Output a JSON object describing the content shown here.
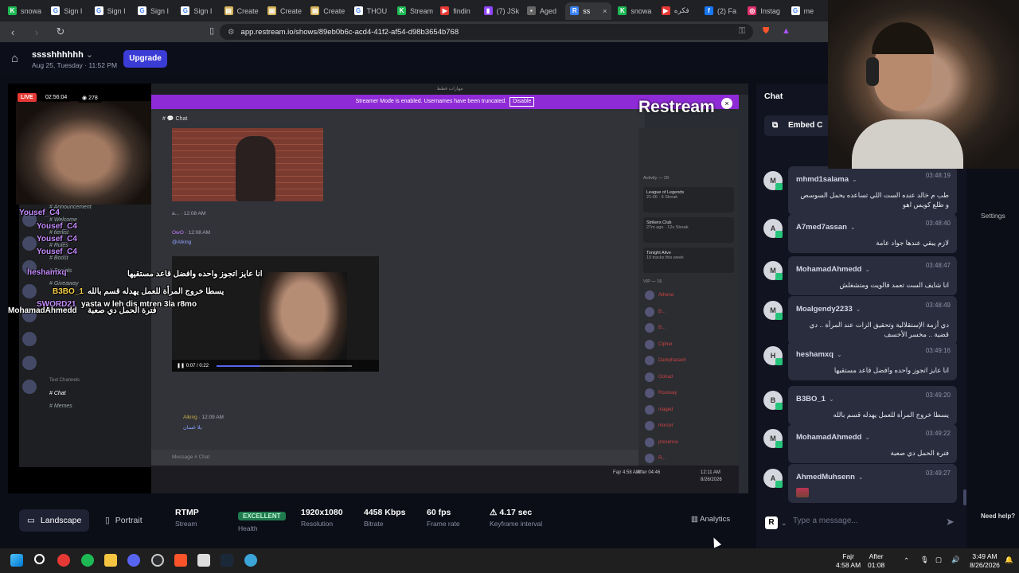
{
  "browser": {
    "tabs": [
      {
        "label": "snowa",
        "color": "#1db954",
        "glyph": "K"
      },
      {
        "label": "Sign I",
        "color": "#fff",
        "glyph": "G"
      },
      {
        "label": "Sign I",
        "color": "#fff",
        "glyph": "G"
      },
      {
        "label": "Sign I",
        "color": "#fff",
        "glyph": "G"
      },
      {
        "label": "Sign I",
        "color": "#fff",
        "glyph": "G"
      },
      {
        "label": "Create",
        "color": "#d4b35a",
        "glyph": "▤"
      },
      {
        "label": "Create",
        "color": "#d4b35a",
        "glyph": "▤"
      },
      {
        "label": "Create",
        "color": "#d4b35a",
        "glyph": "▤"
      },
      {
        "label": "THOU",
        "color": "#fff",
        "glyph": "G"
      },
      {
        "label": "Stream",
        "color": "#1db954",
        "glyph": "K"
      },
      {
        "label": "findin",
        "color": "#e53935",
        "glyph": "▶"
      },
      {
        "label": "(7) JSk",
        "color": "#9146ff",
        "glyph": "▮"
      },
      {
        "label": "Aged",
        "color": "#666",
        "glyph": "▪"
      },
      {
        "label": "ss",
        "color": "#3b82f6",
        "glyph": "R",
        "active": true
      },
      {
        "label": "snowa",
        "color": "#1db954",
        "glyph": "K"
      },
      {
        "label": "فكره",
        "color": "#e53935",
        "glyph": "▶"
      },
      {
        "label": "(2) Fa",
        "color": "#1877f2",
        "glyph": "f"
      },
      {
        "label": "Instag",
        "color": "#e1306c",
        "glyph": "◎"
      },
      {
        "label": "me",
        "color": "#fff",
        "glyph": "G"
      }
    ],
    "close_glyph": "×",
    "url": "app.restream.io/shows/89eb0b6c-acd4-41f2-af54-d98b3654b768"
  },
  "header": {
    "title": "sssshhhhhh",
    "date": "Aug 25, Tuesday · 11:52 PM",
    "upgrade_label": "Upgrade"
  },
  "preview": {
    "live": "LIVE",
    "timer": "02:56:04",
    "viewers": "278",
    "banner_text": "Streamer Mode is enabled. Usernames have been truncated.",
    "banner_button": "Disable",
    "chat_channel": "Chat",
    "watermark": "Restream",
    "message_placeholder": "Message # Chat",
    "video_time": "0:07 / 0:22",
    "msg_user": "OwO",
    "msg_time": "12:08 AM",
    "msg_mention": "@Alking",
    "reply_user": "Alking",
    "reply_time": "12:09 AM",
    "reply_text": "يلا غسان",
    "text_channels_label": "Text Channels",
    "activity_label": "Activity — 29",
    "vip_label": "VIP — 16",
    "cards": [
      {
        "title": "League of Legends",
        "sub": "21:06 · 6 Streak"
      },
      {
        "title": "Strikers Club",
        "sub": "27m ago · 12s Streak"
      },
      {
        "title": "Tonight Alive",
        "sub": "19 tracks this week"
      }
    ],
    "members": [
      "Athena",
      "B...",
      "B...",
      "Cipher",
      "Darkpharaoh",
      "Gohad",
      "Roussay",
      "maged",
      "morcer",
      "presence",
      "R...",
      "Trabox",
      "TrashAGC",
      "Yasuo"
    ],
    "channels": [
      "Announcement",
      "Welcome",
      "tierlist",
      "Rules",
      "Boost",
      "Socials",
      "Giveaway",
      "Chat",
      "Memes"
    ],
    "overlay_names": [
      "Yousef_C4",
      "Yousef_C4",
      "Yousef_C4",
      "Yousef_C4",
      "heshamxq",
      "B3BO_1",
      "SWORD21",
      "MohamadAhmedd"
    ],
    "overlay_msgs": [
      "انا عايز اتجوز واحده وافضل قاعد مستقيها",
      "يسطا خروج المرأة للعمل يهدله قسم بالله",
      "yasta w leh dis mtren 3la r8mo",
      "فترة الحمل دي صعبة"
    ],
    "taskbar_fajr": "Fajr 4:58 AM",
    "taskbar_after": "After 04:46",
    "taskbar_time": "12:11 AM",
    "taskbar_date": "8/26/2026"
  },
  "stats": {
    "landscape": "Landscape",
    "portrait": "Portrait",
    "protocol": {
      "value": "RTMP",
      "label": "Stream"
    },
    "health": {
      "value": "EXCELLENT",
      "label": "Health"
    },
    "resolution": {
      "value": "1920x1080",
      "label": "Resolution"
    },
    "bitrate": {
      "value": "4458 Kbps",
      "label": "Bitrate"
    },
    "framerate": {
      "value": "60 fps",
      "label": "Frame rate"
    },
    "keyframe": {
      "value": "4.17 sec",
      "label": "Keyframe interval"
    },
    "analytics": "Analytics"
  },
  "chat": {
    "title": "Chat",
    "embed": "Embed C",
    "input_placeholder": "Type a message...",
    "settings": "Settings",
    "need_help": "Need help?",
    "messages": [
      {
        "initial": "M",
        "user": "mhmd1salama",
        "time": "03:48:19",
        "text": "طب م خالد عنده الست اللي تساعده يحمل السوسص و طلع كويس اهو"
      },
      {
        "initial": "A",
        "user": "A7med7assan",
        "time": "03:48:40",
        "text": "لازم يبقي عندها جواد عامة"
      },
      {
        "initial": "M",
        "user": "MohamadAhmedd",
        "time": "03:48:47",
        "text": "انا شايف الست تعمد قالويت ومتشغلش"
      },
      {
        "initial": "M",
        "user": "Moalgendy2233",
        "time": "03:48:49",
        "text": "دي أزمة الإستقلالية وتحقيق الزات عند المرأة .. دي قضية .. مخسر الأخسف"
      },
      {
        "initial": "H",
        "user": "heshamxq",
        "time": "03:49:16",
        "text": "انا عايز اتجوز واحده وافضل قاعد مستقيها"
      },
      {
        "initial": "B",
        "user": "B3BO_1",
        "time": "03:49:20",
        "text": "يسطا خروج المرأة للعمل يهدله قسم بالله"
      },
      {
        "initial": "M",
        "user": "MohamadAhmedd",
        "time": "03:49:22",
        "text": "فترة الحمل دي صعبة"
      },
      {
        "initial": "A",
        "user": "AhmedMuhsenn",
        "time": "03:49:27",
        "text": ""
      }
    ]
  },
  "taskbar": {
    "fajr": "Fajr",
    "fajr_time": "4:58 AM",
    "after": "After",
    "after_time": "01:08",
    "time": "3:49 AM",
    "date": "8/26/2026"
  }
}
